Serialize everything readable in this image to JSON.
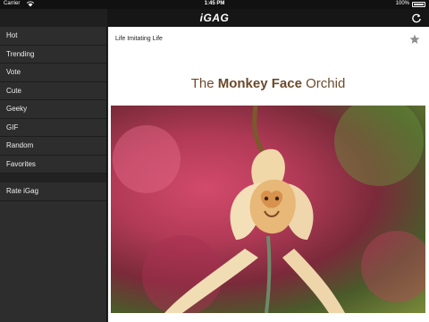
{
  "status": {
    "carrier": "Carrier",
    "time": "1:45 PM",
    "battery": "100%"
  },
  "header": {
    "title": "iGAG"
  },
  "sidebar": {
    "items": [
      {
        "label": "Hot"
      },
      {
        "label": "Trending"
      },
      {
        "label": "Vote"
      },
      {
        "label": "Cute"
      },
      {
        "label": "Geeky"
      },
      {
        "label": "GIF"
      },
      {
        "label": "Random"
      },
      {
        "label": "Favorites"
      }
    ],
    "rate_label": "Rate iGag"
  },
  "post": {
    "title": "Life Imitating Life",
    "heading": {
      "part1": "The ",
      "bold": "Monkey Face",
      "part2": " Orchid"
    }
  },
  "icons": {
    "refresh": "refresh-icon",
    "favorite": "star-icon",
    "battery": "battery-icon",
    "wifi": "wifi-icon"
  },
  "colors": {
    "sidebar_bg": "#2d2d2d",
    "nav_bg": "#161616",
    "heading_text": "#6b4a2a",
    "star": "#8e8e8e"
  }
}
